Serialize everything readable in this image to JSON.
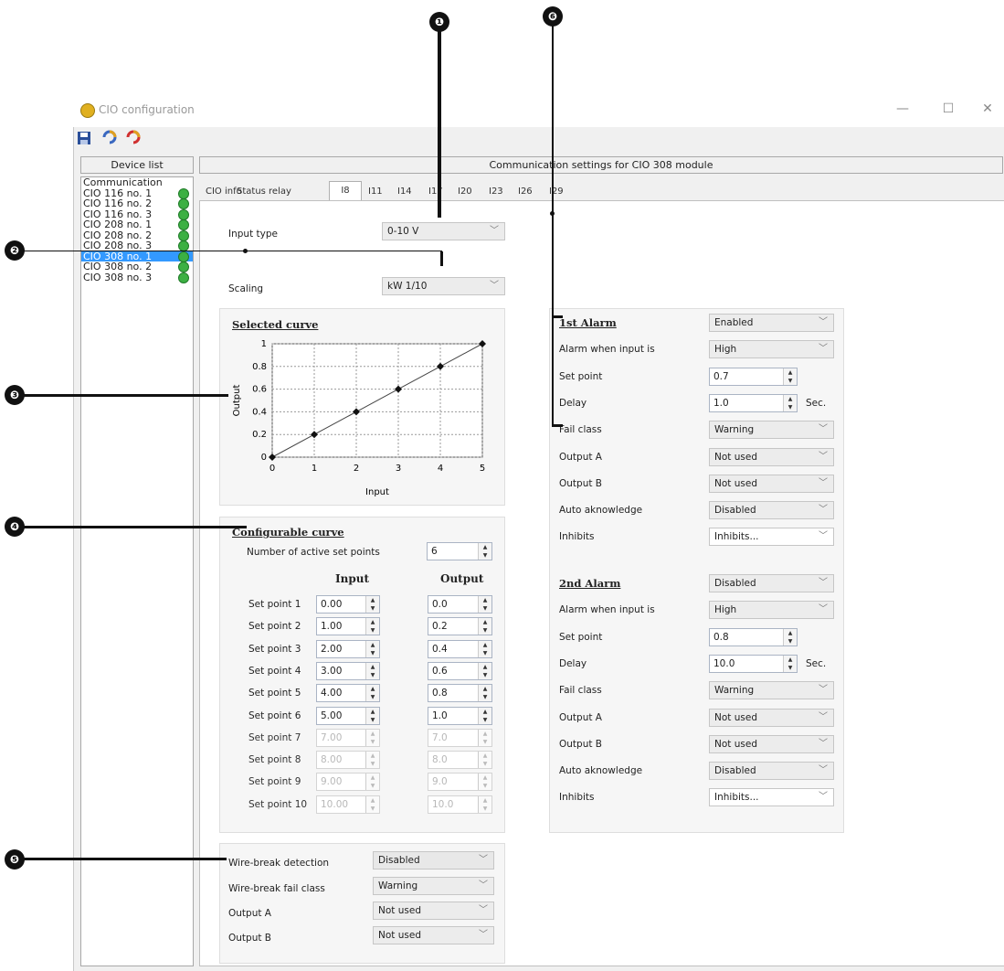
{
  "window": {
    "title": "CIO configuration",
    "controls": {
      "minimize": "—",
      "maximize": "☐",
      "close": "✕"
    }
  },
  "toolbar": {
    "icons": [
      "save-icon",
      "refresh-icon",
      "revert-icon"
    ]
  },
  "device_list": {
    "header": "Device list",
    "items": [
      {
        "label": "Communication",
        "status": false,
        "selected": false
      },
      {
        "label": "CIO 116 no. 1",
        "status": true,
        "selected": false
      },
      {
        "label": "CIO 116 no. 2",
        "status": true,
        "selected": false
      },
      {
        "label": "CIO 116 no. 3",
        "status": true,
        "selected": false
      },
      {
        "label": "CIO 208 no. 1",
        "status": true,
        "selected": false
      },
      {
        "label": "CIO 208 no. 2",
        "status": true,
        "selected": false
      },
      {
        "label": "CIO 208 no. 3",
        "status": true,
        "selected": false
      },
      {
        "label": "CIO 308 no. 1",
        "status": true,
        "selected": true
      },
      {
        "label": "CIO 308 no. 2",
        "status": true,
        "selected": false
      },
      {
        "label": "CIO 308 no. 3",
        "status": true,
        "selected": false
      }
    ]
  },
  "main": {
    "header": "Communication settings for CIO 308 module",
    "tabs": [
      "CIO info",
      "Status relay",
      "I8",
      "I11",
      "I14",
      "I17",
      "I20",
      "I23",
      "I26",
      "I29"
    ],
    "active_tab": "I8"
  },
  "input": {
    "input_type_label": "Input type",
    "input_type_value": "0-10 V",
    "scaling_label": "Scaling",
    "scaling_value": "kW 1/10"
  },
  "selected_curve": {
    "title": "Selected curve",
    "xlabel": "Input",
    "ylabel": "Output"
  },
  "chart_data": {
    "type": "line",
    "x": [
      0,
      1,
      2,
      3,
      4,
      5
    ],
    "y": [
      0.0,
      0.2,
      0.4,
      0.6,
      0.8,
      1.0
    ],
    "xlabel": "Input",
    "ylabel": "Output",
    "xlim": [
      0,
      5
    ],
    "ylim": [
      0,
      1
    ],
    "xticks": [
      "0",
      "1",
      "2",
      "3",
      "4",
      "5"
    ],
    "yticks": [
      "0",
      "0.2",
      "0.4",
      "0.6",
      "0.8",
      "1"
    ],
    "grid": true
  },
  "configurable_curve": {
    "title": "Configurable curve",
    "active_label": "Number of active set points",
    "active_value": "6",
    "input_header": "Input",
    "output_header": "Output",
    "set_points": [
      {
        "label": "Set point 1",
        "input": "0.00",
        "output": "0.0",
        "enabled": true
      },
      {
        "label": "Set point 2",
        "input": "1.00",
        "output": "0.2",
        "enabled": true
      },
      {
        "label": "Set point 3",
        "input": "2.00",
        "output": "0.4",
        "enabled": true
      },
      {
        "label": "Set point 4",
        "input": "3.00",
        "output": "0.6",
        "enabled": true
      },
      {
        "label": "Set point 5",
        "input": "4.00",
        "output": "0.8",
        "enabled": true
      },
      {
        "label": "Set point 6",
        "input": "5.00",
        "output": "1.0",
        "enabled": true
      },
      {
        "label": "Set point 7",
        "input": "7.00",
        "output": "7.0",
        "enabled": false
      },
      {
        "label": "Set point 8",
        "input": "8.00",
        "output": "8.0",
        "enabled": false
      },
      {
        "label": "Set point 9",
        "input": "9.00",
        "output": "9.0",
        "enabled": false
      },
      {
        "label": "Set point 10",
        "input": "10.00",
        "output": "10.0",
        "enabled": false
      }
    ]
  },
  "wire_break": {
    "detection_label": "Wire-break detection",
    "detection_value": "Disabled",
    "fail_class_label": "Wire-break fail class",
    "fail_class_value": "Warning",
    "output_a_label": "Output A",
    "output_a_value": "Not used",
    "output_b_label": "Output B",
    "output_b_value": "Not used"
  },
  "alarm1": {
    "title": "1st Alarm",
    "enabled_value": "Enabled",
    "when_label": "Alarm when input is",
    "when_value": "High",
    "setpoint_label": "Set point",
    "setpoint_value": "0.7",
    "delay_label": "Delay",
    "delay_value": "1.0",
    "delay_unit": "Sec.",
    "fail_class_label": "Fail class",
    "fail_class_value": "Warning",
    "output_a_label": "Output A",
    "output_a_value": "Not used",
    "output_b_label": "Output B",
    "output_b_value": "Not used",
    "ack_label": "Auto aknowledge",
    "ack_value": "Disabled",
    "inhibits_label": "Inhibits",
    "inhibits_value": "Inhibits..."
  },
  "alarm2": {
    "title": "2nd Alarm",
    "enabled_value": "Disabled",
    "when_label": "Alarm when input is",
    "when_value": "High",
    "setpoint_label": "Set point",
    "setpoint_value": "0.8",
    "delay_label": "Delay",
    "delay_value": "10.0",
    "delay_unit": "Sec.",
    "fail_class_label": "Fail class",
    "fail_class_value": "Warning",
    "output_a_label": "Output A",
    "output_a_value": "Not used",
    "output_b_label": "Output B",
    "output_b_value": "Not used",
    "ack_label": "Auto aknowledge",
    "ack_value": "Disabled",
    "inhibits_label": "Inhibits",
    "inhibits_value": "Inhibits..."
  },
  "callouts": [
    "❶",
    "❷",
    "❸",
    "❹",
    "❺",
    "❻"
  ]
}
